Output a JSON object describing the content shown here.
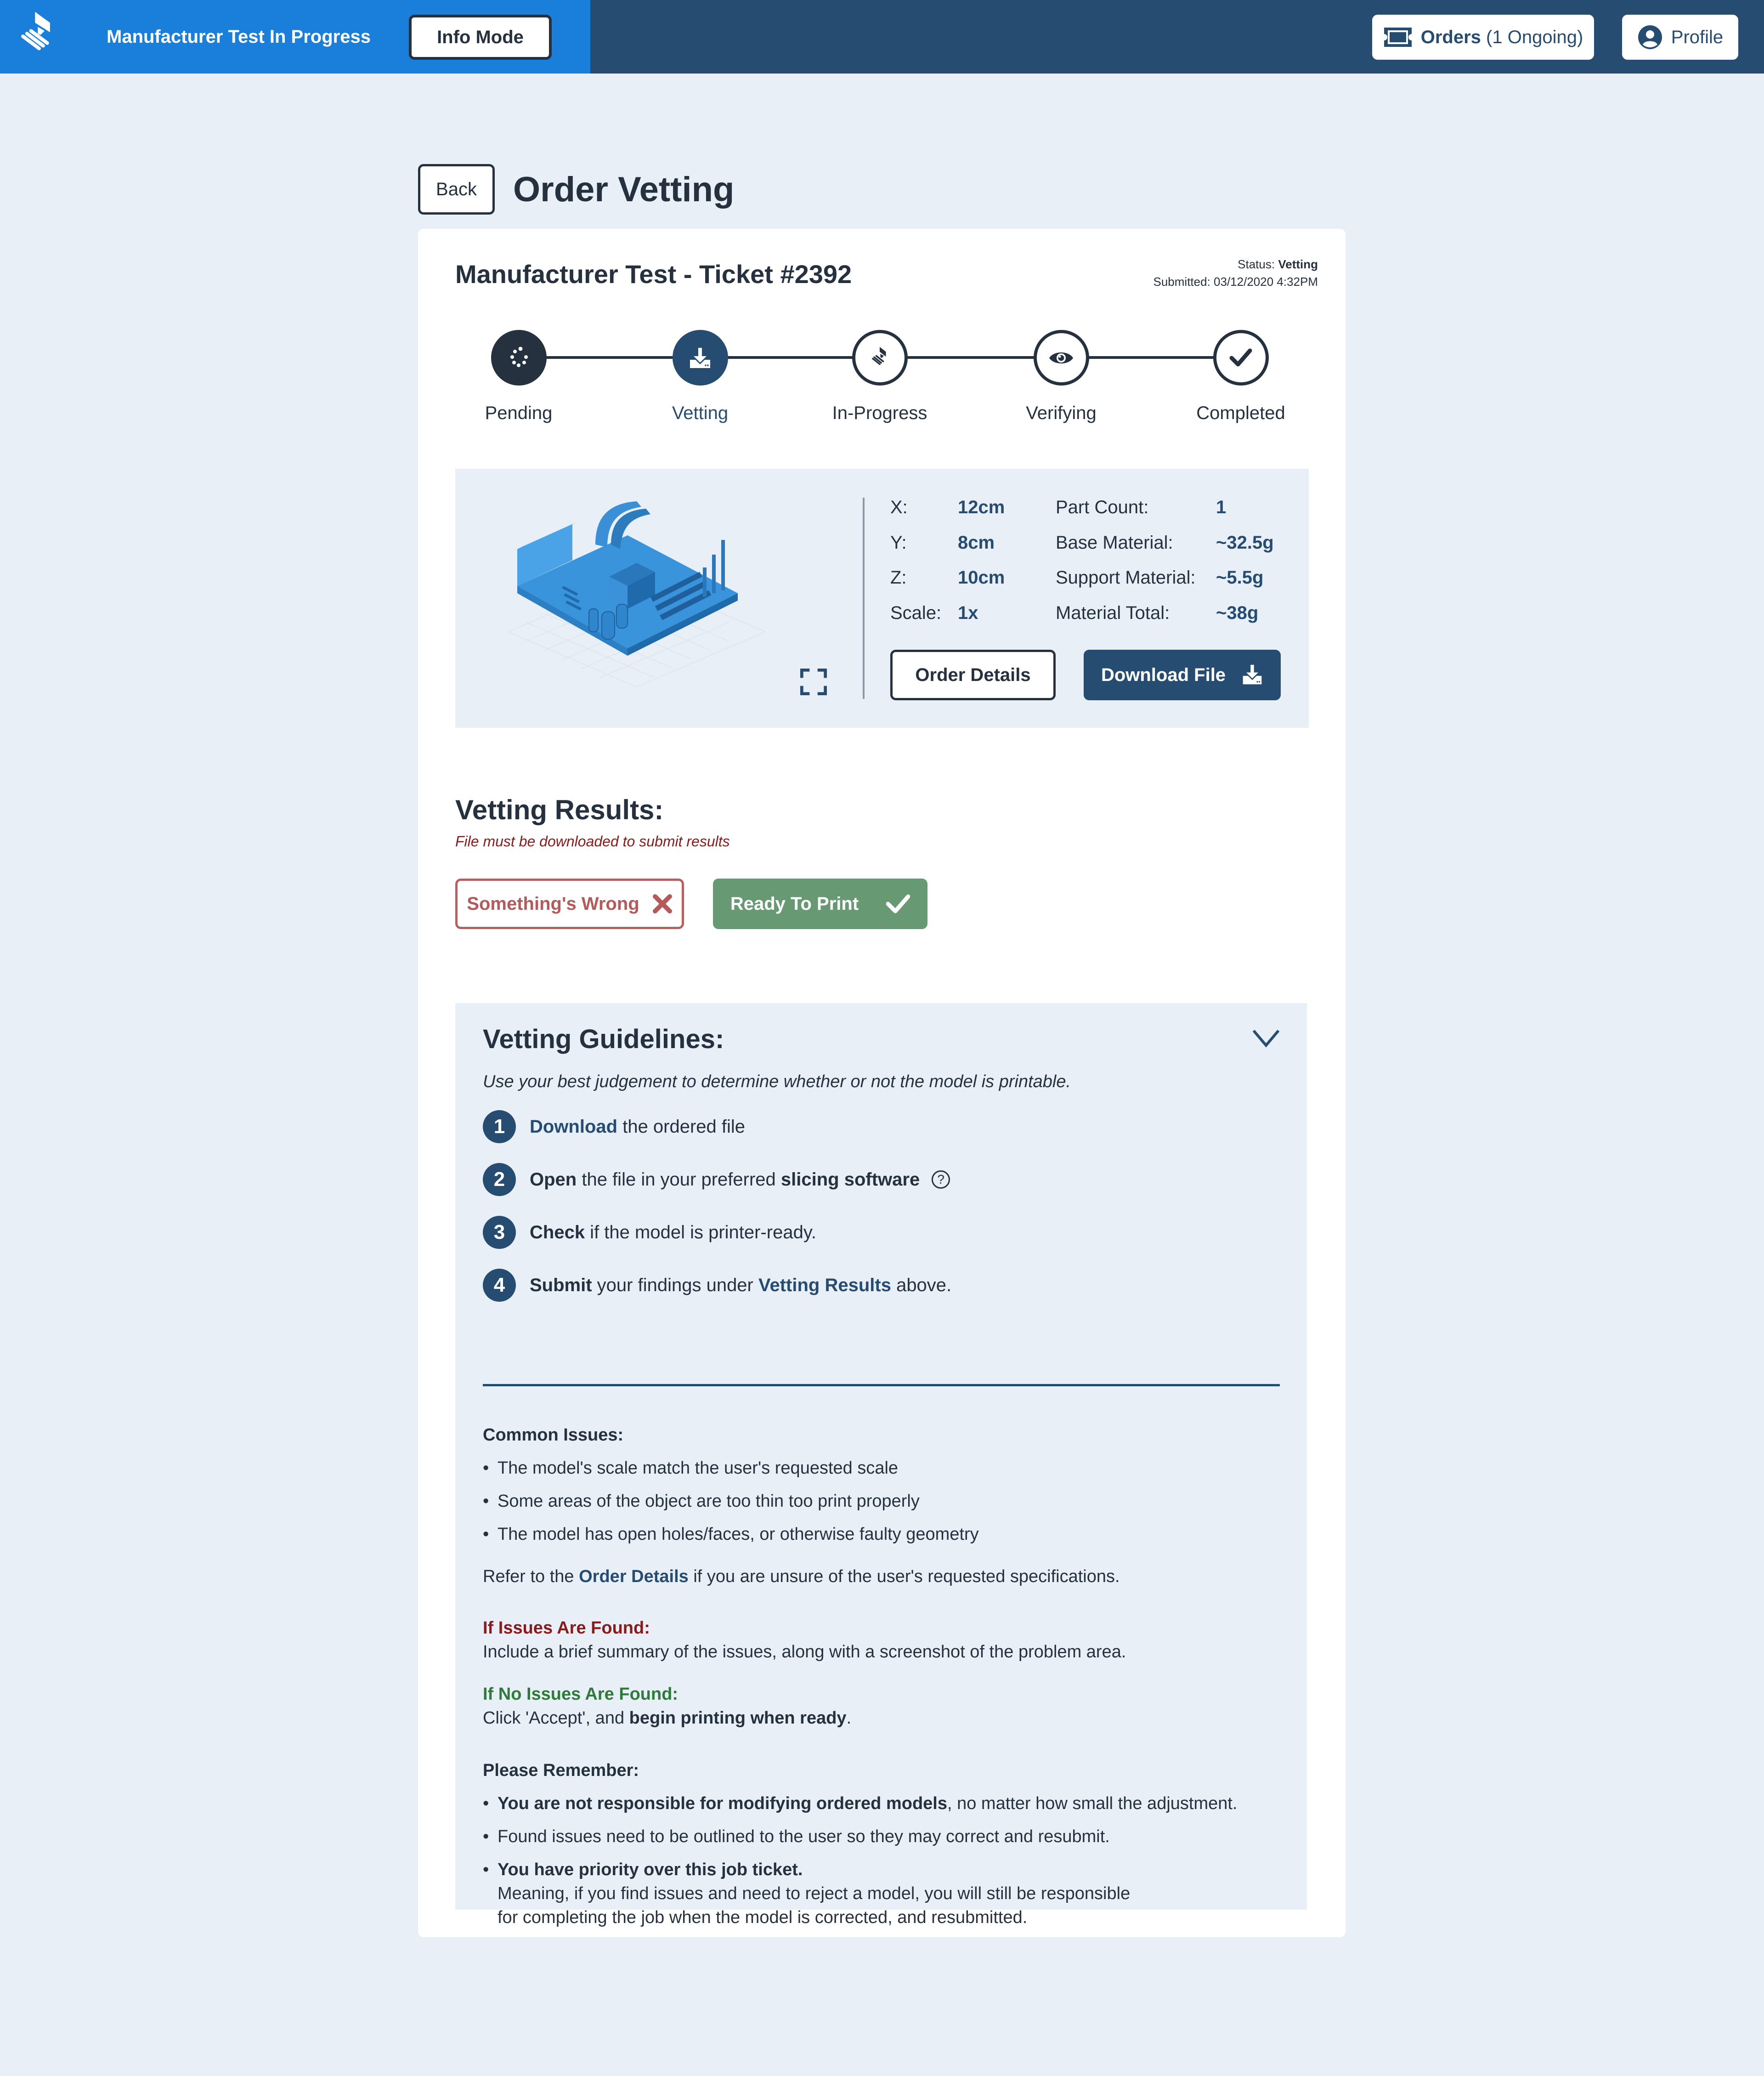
{
  "header": {
    "app_title": "Manufacturer Test In Progress",
    "info_mode_label": "Info Mode",
    "orders_label": "Orders",
    "orders_count": "(1 Ongoing)",
    "profile_label": "Profile",
    "icons": {
      "logo": "printer-logo-icon",
      "orders": "ticket-icon",
      "profile": "user-circle-icon"
    }
  },
  "page": {
    "back_label": "Back",
    "title": "Order Vetting"
  },
  "ticket": {
    "title": "Manufacturer Test - Ticket #2392",
    "status_label": "Status:",
    "status_value": "Vetting",
    "submitted_label": "Submitted:",
    "submitted_value": "03/12/2020 4:32PM"
  },
  "stepper": {
    "current": "Vetting",
    "steps": [
      {
        "label": "Pending",
        "icon": "spinner-icon",
        "state": "done"
      },
      {
        "label": "Vetting",
        "icon": "download-icon",
        "state": "active"
      },
      {
        "label": "In-Progress",
        "icon": "printer-icon",
        "state": "upcoming"
      },
      {
        "label": "Verifying",
        "icon": "eye-icon",
        "state": "upcoming"
      },
      {
        "label": "Completed",
        "icon": "check-icon",
        "state": "upcoming"
      }
    ]
  },
  "model": {
    "specs_left": [
      {
        "label": "X:",
        "value": "12cm"
      },
      {
        "label": "Y:",
        "value": "8cm"
      },
      {
        "label": "Z:",
        "value": "10cm"
      },
      {
        "label": "Scale:",
        "value": "1x"
      }
    ],
    "specs_right": [
      {
        "label": "Part Count:",
        "value": "1"
      },
      {
        "label": "Base Material:",
        "value": "~32.5g"
      },
      {
        "label": "Support Material:",
        "value": "~5.5g"
      },
      {
        "label": "Material Total:",
        "value": "~38g"
      }
    ],
    "order_details_label": "Order Details",
    "download_label": "Download File"
  },
  "vetting_results": {
    "title": "Vetting Results:",
    "note": "File must be downloaded to submit results",
    "wrong_label": "Something's Wrong",
    "ready_label": "Ready To Print"
  },
  "guidelines": {
    "title": "Vetting Guidelines:",
    "subtitle": "Use your best judgement to determine whether or not the model is printable.",
    "steps": [
      {
        "num": "1",
        "strong": "Download",
        "rest": " the ordered file"
      },
      {
        "num": "2",
        "strong": "Open",
        "rest": " the file in your preferred ",
        "strong2": "slicing software"
      },
      {
        "num": "3",
        "strong": "Check",
        "rest": " if the model is printer-ready."
      },
      {
        "num": "4",
        "strong": "Submit",
        "rest": " your findings under ",
        "link": "Vetting Results",
        "tail": " above."
      }
    ],
    "common_issues_title": "Common Issues:",
    "common_issues": [
      "The model's scale match the user's requested scale",
      "Some areas of the object are too thin too print properly",
      "The model has open holes/faces, or otherwise faulty geometry"
    ],
    "refer_pre": "Refer to the ",
    "refer_link": "Order Details",
    "refer_post": " if you are unsure of the user's requested specifications.",
    "issues_found_title": "If Issues Are Found:",
    "issues_found_text": "Include a brief summary of the issues, along with a screenshot of the problem area.",
    "no_issues_title": "If No Issues Are Found:",
    "no_issues_pre": "Click 'Accept', and ",
    "no_issues_bold": "begin printing when ready",
    "no_issues_post": ".",
    "remember_title": "Please Remember:",
    "remember_1_bold": "You are not responsible for modifying ordered models",
    "remember_1_rest": ", no matter how small the adjustment.",
    "remember_2": "Found issues need to be outlined to the user so they may correct and resubmit.",
    "remember_3_bold": "You have priority over this job ticket.",
    "remember_3_line2": "Meaning, if you find issues and need to reject a model, you will still be responsible",
    "remember_3_line3": "for completing the job when the model is corrected, and resubmitted."
  },
  "colors": {
    "header_blue": "#1a7fdb",
    "navy": "#264d71",
    "dark": "#25313f",
    "page_bg": "#e9eff7",
    "danger": "#b55a5a",
    "success": "#679a72",
    "note_red": "#8b1a1a",
    "green_text": "#2e7a3a"
  }
}
